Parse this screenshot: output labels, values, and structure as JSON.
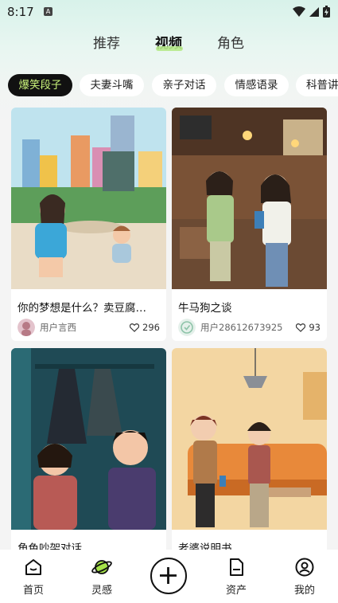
{
  "status_bar": {
    "time": "8:17",
    "notif": "A"
  },
  "top_tabs": [
    {
      "label": "推荐",
      "active": false
    },
    {
      "label": "视频",
      "active": true
    },
    {
      "label": "角色",
      "active": false
    }
  ],
  "chips": [
    {
      "label": "爆笑段子",
      "active": true
    },
    {
      "label": "夫妻斗嘴",
      "active": false
    },
    {
      "label": "亲子对话",
      "active": false
    },
    {
      "label": "情感语录",
      "active": false
    },
    {
      "label": "科普讲",
      "active": false
    }
  ],
  "cards": [
    {
      "title": "你的梦想是什么？卖豆腐…",
      "author": "用户言西",
      "likes": "296"
    },
    {
      "title": "牛马狗之谈",
      "author": "用户28612673925",
      "likes": "93"
    },
    {
      "title": "角色吵架对话",
      "author": "",
      "likes": ""
    },
    {
      "title": "老婆说明书",
      "author": "",
      "likes": ""
    }
  ],
  "bottom_nav": {
    "home": "首页",
    "inspiration": "灵感",
    "assets": "资产",
    "mine": "我的"
  },
  "colors": {
    "accent": "#c9f27a",
    "chip_active_bg": "#111111"
  }
}
